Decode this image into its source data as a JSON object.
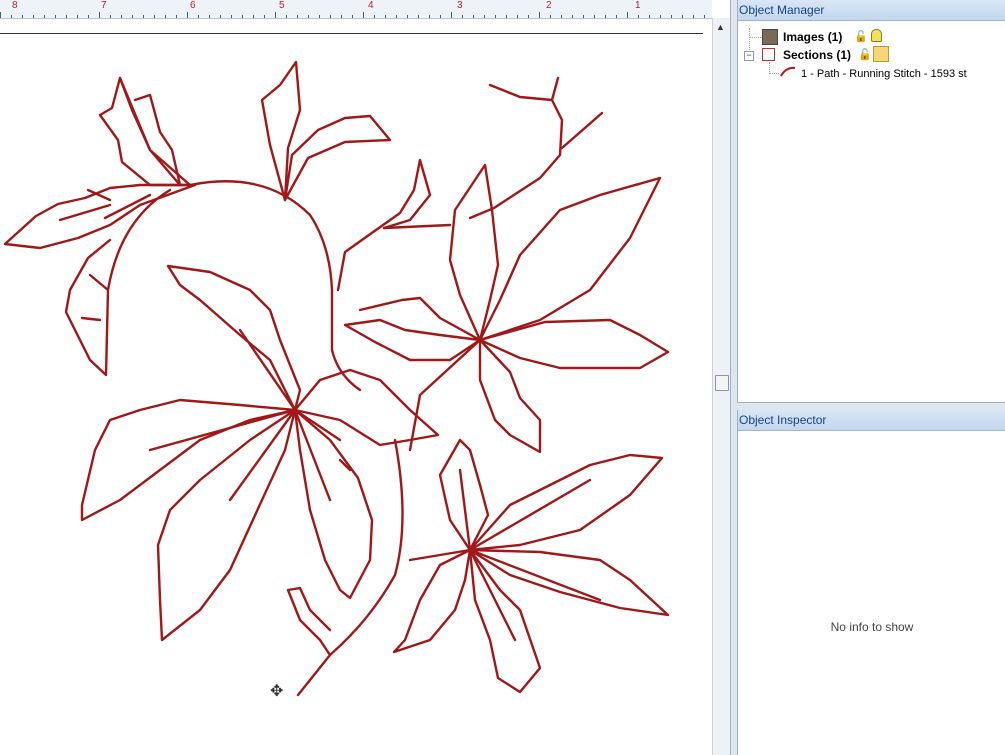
{
  "ruler": {
    "labels": [
      "8",
      "7",
      "6",
      "5",
      "4",
      "3",
      "2",
      "1"
    ]
  },
  "object_manager": {
    "title": "Object Manager",
    "tree": [
      {
        "label": "Images (1)",
        "icon": "image-icon",
        "lock": "lock-icon",
        "visibility": "bulb-icon"
      },
      {
        "label": "Sections (1)",
        "icon": "section-icon",
        "lock": "lock-icon",
        "visibility": "bulb-icon-active"
      },
      {
        "label": "1 - Path - Running Stitch - 1593 st",
        "icon": "path-stitch-icon"
      }
    ]
  },
  "object_inspector": {
    "title": "Object Inspector",
    "empty_text": "No info to show"
  },
  "colors": {
    "stitch": "#a01818",
    "panel_title": "#15428b",
    "ruler_numbers": "#c02020"
  }
}
